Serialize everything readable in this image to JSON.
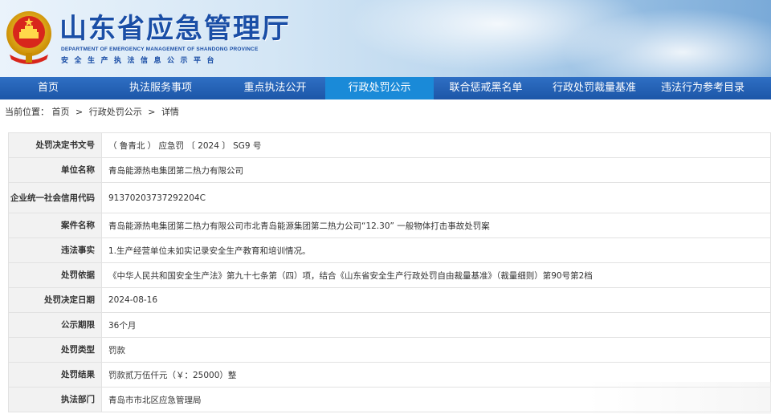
{
  "header": {
    "site_title": "山东省应急管理厅",
    "site_subtitle_en": "DEPARTMENT OF EMERGENCY MANAGEMENT OF SHANDONG PROVINCE",
    "site_subtitle_cn": "安全生产执法信息公示平台",
    "brand_color": "#1a4ea6",
    "emblem_icon": "national-emblem-icon"
  },
  "nav": {
    "items": [
      {
        "label": "首页"
      },
      {
        "label": "执法服务事项"
      },
      {
        "label": "重点执法公开"
      },
      {
        "label": "行政处罚公示"
      },
      {
        "label": "联合惩戒黑名单"
      },
      {
        "label": "行政处罚裁量基准"
      },
      {
        "label": "违法行为参考目录"
      }
    ],
    "active_index": 3,
    "bar_color": "#1c56a8",
    "active_color": "#1a8ad8"
  },
  "breadcrumb": {
    "prefix": "当前位置：",
    "items": [
      "首页",
      "行政处罚公示",
      "详情"
    ],
    "separator": ">"
  },
  "detail": {
    "rows": [
      {
        "label": "处罚决定书文号",
        "value": "（ 鲁青北 ） 应急罚 〔 2024 〕 SG9 号"
      },
      {
        "label": "单位名称",
        "value": "青岛能源热电集团第二热力有限公司"
      },
      {
        "label": "企业统一社会信用代码",
        "value": "91370203737292204C"
      },
      {
        "label": "案件名称",
        "value": "青岛能源热电集团第二热力有限公司市北青岛能源集团第二热力公司“12.30” 一般物体打击事故处罚案"
      },
      {
        "label": "违法事实",
        "value": "1.生产经营单位未如实记录安全生产教育和培训情况。"
      },
      {
        "label": "处罚依据",
        "value": "《中华人民共和国安全生产法》第九十七条第（四）项，结合《山东省安全生产行政处罚自由裁量基准》（裁量细则）第90号第2档"
      },
      {
        "label": "处罚决定日期",
        "value": "2024-08-16"
      },
      {
        "label": "公示期限",
        "value": "36个月"
      },
      {
        "label": "处罚类型",
        "value": "罚款"
      },
      {
        "label": "处罚结果",
        "value": "罚款贰万伍仟元（￥：25000）整"
      },
      {
        "label": "执法部门",
        "value": "青岛市市北区应急管理局"
      }
    ]
  }
}
